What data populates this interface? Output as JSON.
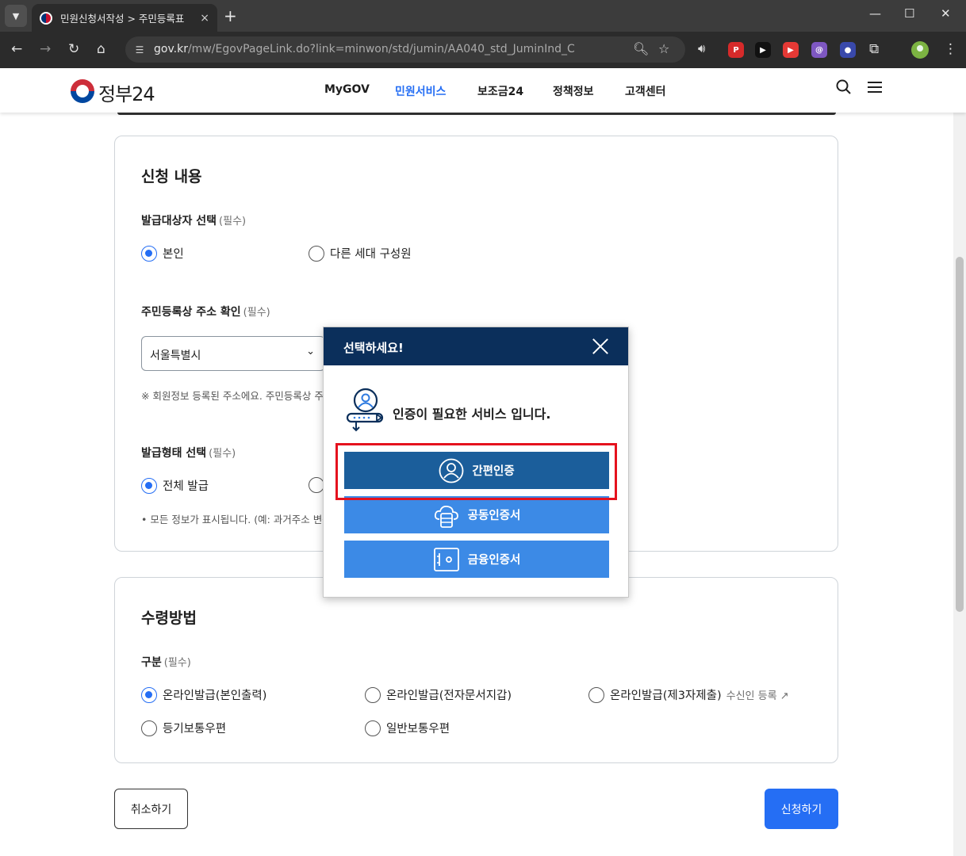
{
  "browser": {
    "tab_title": "민원신청서작성 > 주민등록표",
    "tab_close": "×",
    "new_tab": "+",
    "url_host": "gov.kr",
    "url_path": "/mw/EgovPageLink.do?link=minwon/std/jumin/AA040_std_JuminInd_C",
    "extensions": [
      {
        "name": "ext-p-icon",
        "label": "P",
        "color": "#d62a2a"
      },
      {
        "name": "ext-cursor-icon",
        "label": "▶",
        "color": "#111111"
      },
      {
        "name": "ext-red-icon",
        "label": "▶",
        "color": "#e53935"
      },
      {
        "name": "ext-purple-icon",
        "label": "@",
        "color": "#7e57c2"
      },
      {
        "name": "ext-colorful-icon",
        "label": "●",
        "color": "#3949ab"
      }
    ]
  },
  "site": {
    "logo_text": "정부24",
    "nav": [
      "MyGOV",
      "민원서비스",
      "보조금24",
      "정책정보",
      "고객센터"
    ],
    "active_nav": "민원서비스"
  },
  "application": {
    "title": "신청 내용",
    "target_label": "발급대상자 선택",
    "required": "(필수)",
    "target_options": [
      "본인",
      "다른 세대 구성원"
    ],
    "target_selected": "본인",
    "address_label": "주민등록상 주소 확인",
    "address_value": "서울특별시",
    "address_note": "※ 회원정보 등록된 주소에요. 주민등록상 주",
    "format_label": "발급형태 선택",
    "format_options": [
      "전체 발급"
    ],
    "format_selected": "전체 발급",
    "format_note": "• 모든 정보가 표시됩니다. (예: 과거주소 변동"
  },
  "receipt": {
    "title": "수령방법",
    "label": "구분",
    "required": "(필수)",
    "options": [
      "온라인발급(본인출력)",
      "온라인발급(전자문서지갑)",
      "온라인발급(제3자제출)",
      "등기보통우편",
      "일반보통우편"
    ],
    "selected": "온라인발급(본인출력)",
    "recipient_link": "수신인 등록"
  },
  "actions": {
    "cancel": "취소하기",
    "submit": "신청하기"
  },
  "modal": {
    "title": "선택하세요!",
    "message": "인증이 필요한 서비스 입니다.",
    "buttons": [
      "간편인증",
      "공동인증서",
      "금융인증서"
    ]
  }
}
